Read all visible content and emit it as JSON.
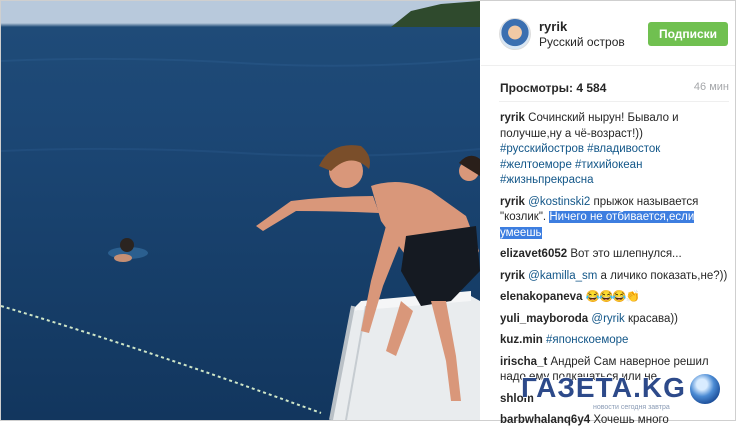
{
  "header": {
    "username": "ryrik",
    "location": "Русский остров",
    "follow_label": "Подписки"
  },
  "stats": {
    "views": "Просмотры: 4 584",
    "time": "46 мин"
  },
  "comments": [
    {
      "user": "ryrik",
      "text": "Сочинский нырун! Бывало и получше,ну а чё-возраст!))",
      "tags": "#русскийостров #владивосток #желтоеморе #тихийокеан #жизньпрекрасна"
    },
    {
      "user": "ryrik",
      "mention": "@kostinski2",
      "text_a": "прыжок называется \"козлик\".",
      "text_sel": "Ничего не отбивается,если умеешь"
    },
    {
      "user": "elizavet6052",
      "text": "Вот это шлепнулся..."
    },
    {
      "user": "ryrik",
      "mention": "@kamilla_sm",
      "text": "а личико показать,не?))"
    },
    {
      "user": "elenakopaneva",
      "text": "😂😂😂👏"
    },
    {
      "user": "yuli_mayboroda",
      "mention": "@ryrik",
      "text": "красава))"
    },
    {
      "user": "kuz.min",
      "tags": "#японскоеморе"
    },
    {
      "user": "irischa_t",
      "text": "Андрей Сам наверное решил надо ему подкачаться,или не"
    },
    {
      "user": "shlom",
      "text": ""
    },
    {
      "user": "barbwhalanq6y4",
      "text": "Хочешь много"
    }
  ],
  "watermark": {
    "brand": "ГАЗЕТА.KG",
    "slogan": "новости сегодня завтра"
  },
  "colors": {
    "follow": "#70c050",
    "link": "#125688",
    "selection": "#3d7ee0"
  }
}
